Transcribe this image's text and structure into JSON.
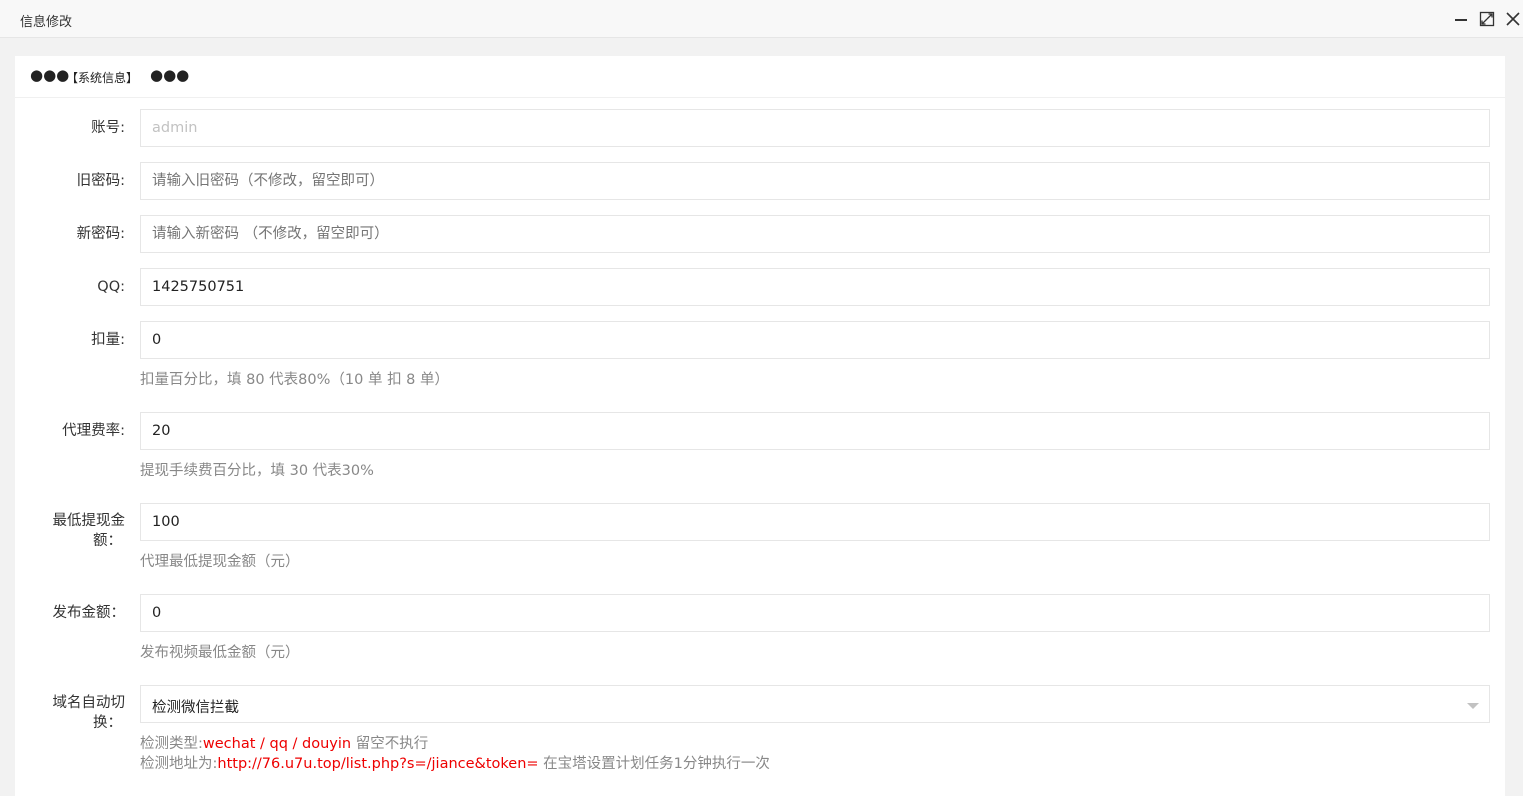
{
  "window": {
    "title": "信息修改",
    "buttons": {
      "minimize": "minimize-icon",
      "maximize": "maximize-icon",
      "close": "close-icon"
    }
  },
  "section": {
    "dots_left": "●●●",
    "title": "【系统信息】",
    "dots_right": "●●●"
  },
  "form": {
    "account": {
      "label": "账号:",
      "placeholder": "admin"
    },
    "old_password": {
      "label": "旧密码:",
      "placeholder": "请输入旧密码（不修改，留空即可）"
    },
    "new_password": {
      "label": "新密码:",
      "placeholder": "请输入新密码 （不修改，留空即可）"
    },
    "qq": {
      "label": "QQ:",
      "value": "1425750751"
    },
    "deduction": {
      "label": "扣量:",
      "value": "0",
      "hint": "扣量百分比，填 80 代表80%（10 单 扣 8 单）"
    },
    "agent_fee": {
      "label": "代理费率:",
      "value": "20",
      "hint": "提现手续费百分比，填 30 代表30%"
    },
    "min_withdraw": {
      "label_line1": "最低提现金",
      "label_line2": "额：",
      "value": "100",
      "hint": "代理最低提现金额（元）"
    },
    "publish_amount": {
      "label": "发布金额：",
      "value": "0",
      "hint": "发布视频最低金额（元）"
    },
    "domain_switch": {
      "label_line1": "域名自动切",
      "label_line2": "换：",
      "selected": "检测微信拦截",
      "hint1_prefix": "检测类型:",
      "hint1_red": "wechat / qq / douyin",
      "hint1_suffix": " 留空不执行",
      "hint2_prefix": "检测地址为:",
      "hint2_red": "http://76.u7u.top/list.php?s=/jiance&token=",
      "hint2_suffix": " 在宝塔设置计划任务1分钟执行一次"
    }
  }
}
